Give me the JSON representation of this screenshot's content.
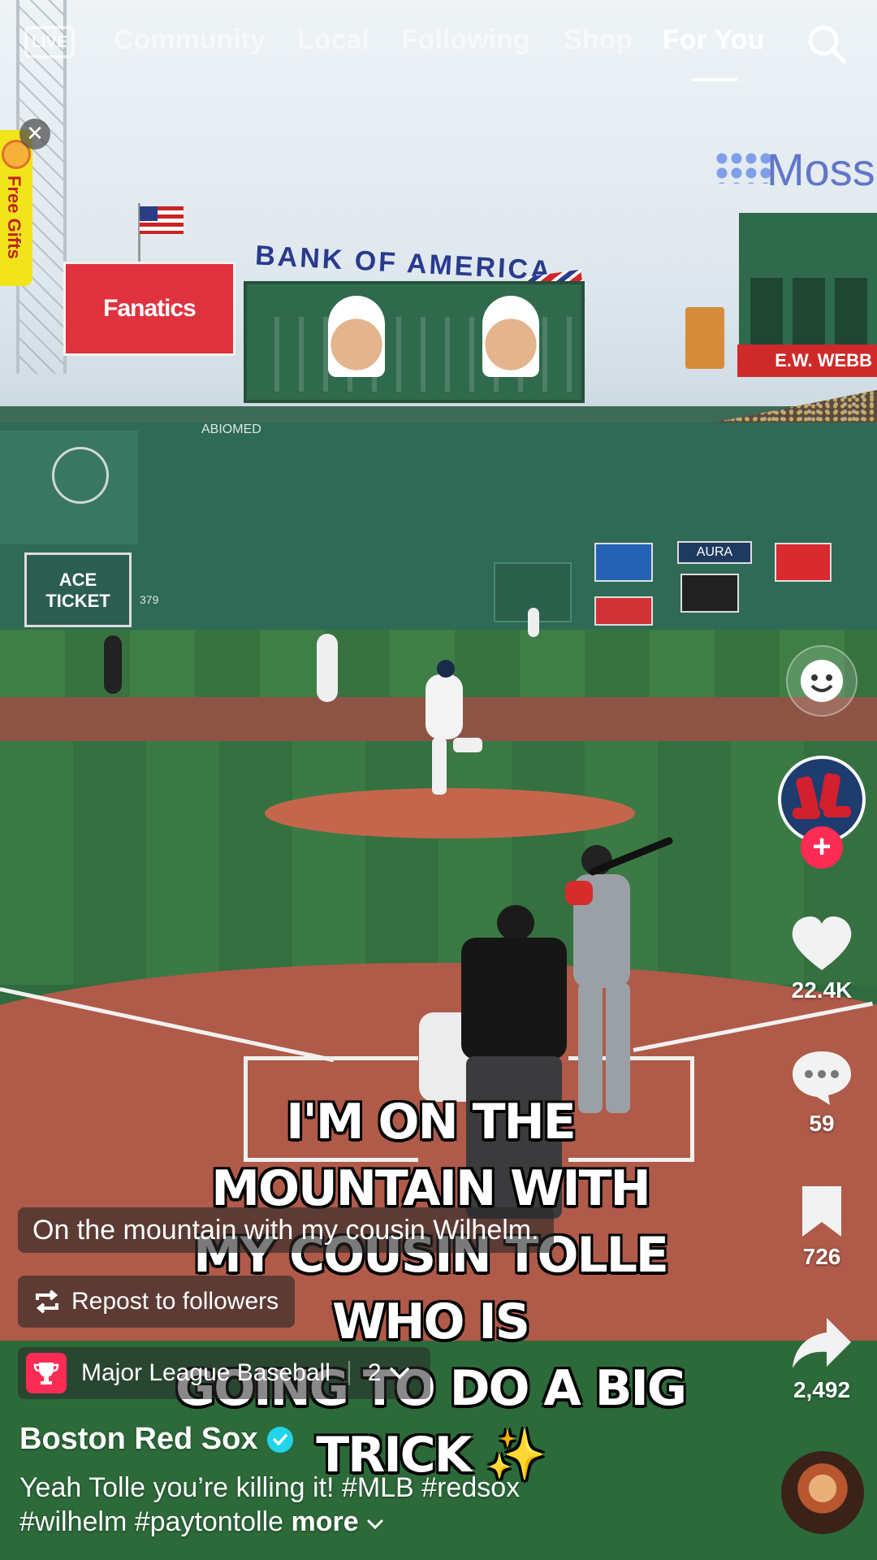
{
  "topbar": {
    "live_label": "LIVE",
    "tabs": [
      "Community",
      "Local",
      "Following",
      "Shop",
      "For You"
    ],
    "active_tab": "For You"
  },
  "promo": {
    "label": "Free Gifts",
    "close_symbol": "✕"
  },
  "video_scene": {
    "fanatics_sign": "Fanatics",
    "bank_sign": "BANK OF AMERICA",
    "moss_sign": "Moss",
    "ew_sign": "E.W. WEBB",
    "ace_sign": "ACE TICKET",
    "aura_sign": "AURA",
    "wall_number": "379"
  },
  "caption_overlay": {
    "line1": "I'M ON THE MOUNTAIN WITH",
    "line2": "MY COUSIN TOLLE WHO IS",
    "line3": "GOING TO DO A BIG TRICK",
    "sparkle": "✨"
  },
  "subtitle_chip": "On the mountain with my cousin Wilhelm.",
  "repost_chip": "Repost to followers",
  "mlb_chip": {
    "label": "Major League Baseball",
    "count": "2"
  },
  "rail": {
    "likes": "22.4K",
    "comments": "59",
    "saves": "726",
    "shares": "2,492"
  },
  "post": {
    "author": "Boston Red Sox",
    "description": "Yeah Tolle you’re killing it! #MLB #redsox",
    "description_line2": "#wilhelm #paytontolle",
    "more_label": "more"
  },
  "colors": {
    "accent": "#fe2c55",
    "verified": "#20d5ec"
  }
}
